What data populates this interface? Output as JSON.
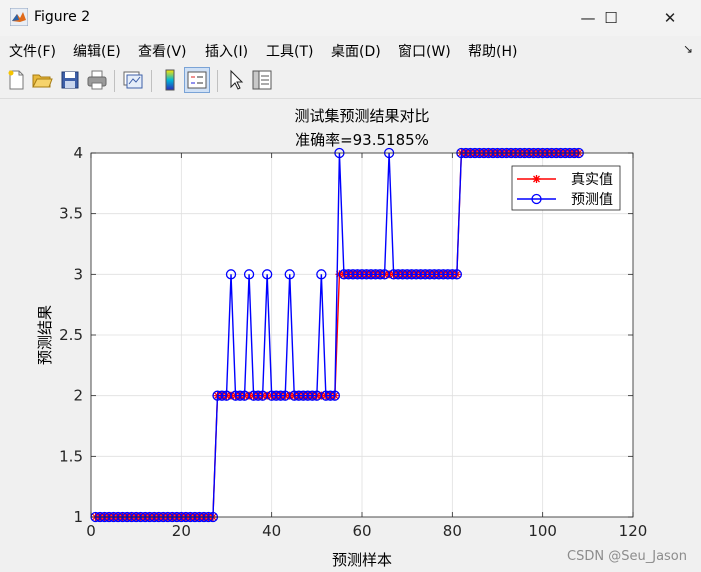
{
  "window": {
    "title": "Figure 2",
    "controls": {
      "minimize": "—",
      "maximize": "☐",
      "close": "✕"
    }
  },
  "menubar": {
    "items": [
      {
        "label": "文件(F)",
        "name": "menu-file"
      },
      {
        "label": "编辑(E)",
        "name": "menu-edit"
      },
      {
        "label": "查看(V)",
        "name": "menu-view"
      },
      {
        "label": "插入(I)",
        "name": "menu-insert"
      },
      {
        "label": "工具(T)",
        "name": "menu-tools"
      },
      {
        "label": "桌面(D)",
        "name": "menu-desktop"
      },
      {
        "label": "窗口(W)",
        "name": "menu-window"
      },
      {
        "label": "帮助(H)",
        "name": "menu-help"
      }
    ],
    "overflow_icon": "↘"
  },
  "toolbar": {
    "buttons": [
      "new-figure-icon",
      "open-file-icon",
      "save-icon",
      "print-icon",
      "link-plot-icon",
      "insert-colorbar-icon",
      "insert-legend-icon",
      "pointer-icon",
      "property-editor-icon"
    ]
  },
  "watermark": "CSDN @Seu_Jason",
  "chart_data": {
    "type": "line",
    "title": "测试集预测结果对比",
    "subtitle": "准确率=93.5185%",
    "xlabel": "预测样本",
    "ylabel": "预测结果",
    "xlim": [
      0,
      120
    ],
    "ylim": [
      1,
      4
    ],
    "xticks": [
      0,
      20,
      40,
      60,
      80,
      100,
      120
    ],
    "yticks": [
      1,
      1.5,
      2,
      2.5,
      3,
      3.5,
      4
    ],
    "ytick_labels": [
      "1",
      "1.5",
      "2",
      "2.5",
      "3",
      "3.5",
      "4"
    ],
    "grid": true,
    "legend_position": "top-right",
    "x": [
      1,
      2,
      3,
      4,
      5,
      6,
      7,
      8,
      9,
      10,
      11,
      12,
      13,
      14,
      15,
      16,
      17,
      18,
      19,
      20,
      21,
      22,
      23,
      24,
      25,
      26,
      27,
      28,
      29,
      30,
      31,
      32,
      33,
      34,
      35,
      36,
      37,
      38,
      39,
      40,
      41,
      42,
      43,
      44,
      45,
      46,
      47,
      48,
      49,
      50,
      51,
      52,
      53,
      54,
      55,
      56,
      57,
      58,
      59,
      60,
      61,
      62,
      63,
      64,
      65,
      66,
      67,
      68,
      69,
      70,
      71,
      72,
      73,
      74,
      75,
      76,
      77,
      78,
      79,
      80,
      81,
      82,
      83,
      84,
      85,
      86,
      87,
      88,
      89,
      90,
      91,
      92,
      93,
      94,
      95,
      96,
      97,
      98,
      99,
      100,
      101,
      102,
      103,
      104,
      105,
      106,
      107,
      108
    ],
    "series": [
      {
        "name": "真实值",
        "color": "#ff0000",
        "marker": "star",
        "values": [
          1,
          1,
          1,
          1,
          1,
          1,
          1,
          1,
          1,
          1,
          1,
          1,
          1,
          1,
          1,
          1,
          1,
          1,
          1,
          1,
          1,
          1,
          1,
          1,
          1,
          1,
          1,
          2,
          2,
          2,
          2,
          2,
          2,
          2,
          2,
          2,
          2,
          2,
          2,
          2,
          2,
          2,
          2,
          2,
          2,
          2,
          2,
          2,
          2,
          2,
          2,
          2,
          2,
          2,
          3,
          3,
          3,
          3,
          3,
          3,
          3,
          3,
          3,
          3,
          3,
          3,
          3,
          3,
          3,
          3,
          3,
          3,
          3,
          3,
          3,
          3,
          3,
          3,
          3,
          3,
          3,
          4,
          4,
          4,
          4,
          4,
          4,
          4,
          4,
          4,
          4,
          4,
          4,
          4,
          4,
          4,
          4,
          4,
          4,
          4,
          4,
          4,
          4,
          4,
          4,
          4,
          4,
          4
        ]
      },
      {
        "name": "预测值",
        "color": "#0000ff",
        "marker": "circle",
        "values": [
          1,
          1,
          1,
          1,
          1,
          1,
          1,
          1,
          1,
          1,
          1,
          1,
          1,
          1,
          1,
          1,
          1,
          1,
          1,
          1,
          1,
          1,
          1,
          1,
          1,
          1,
          1,
          2,
          2,
          2,
          3,
          2,
          2,
          2,
          3,
          2,
          2,
          2,
          3,
          2,
          2,
          2,
          2,
          3,
          2,
          2,
          2,
          2,
          2,
          2,
          3,
          2,
          2,
          2,
          4,
          3,
          3,
          3,
          3,
          3,
          3,
          3,
          3,
          3,
          3,
          4,
          3,
          3,
          3,
          3,
          3,
          3,
          3,
          3,
          3,
          3,
          3,
          3,
          3,
          3,
          3,
          4,
          4,
          4,
          4,
          4,
          4,
          4,
          4,
          4,
          4,
          4,
          4,
          4,
          4,
          4,
          4,
          4,
          4,
          4,
          4,
          4,
          4,
          4,
          4,
          4,
          4,
          4
        ]
      }
    ]
  }
}
